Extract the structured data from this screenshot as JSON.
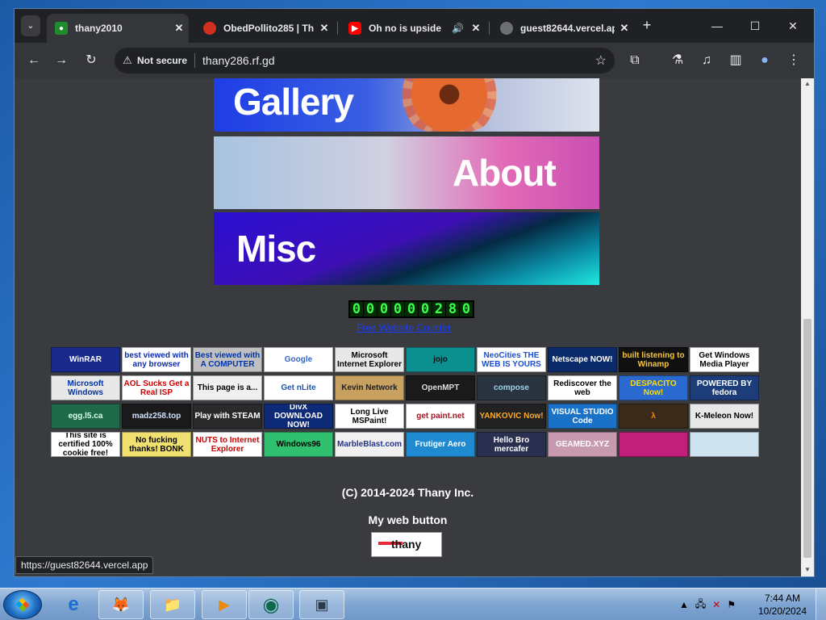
{
  "browser": {
    "tab_menu_icon": "chevron-down-icon",
    "tabs": [
      {
        "title": "thany2010",
        "favicon": "green-square",
        "active": true
      },
      {
        "title": "ObedPollito285 | Th",
        "favicon": "red-fire",
        "active": false
      },
      {
        "title": "Oh no is upside",
        "favicon": "youtube-red",
        "active": false,
        "audio": "🔊"
      },
      {
        "title": "guest82644.vercel.ap",
        "favicon": "globe",
        "active": false
      }
    ],
    "tab_close_glyph": "✕",
    "new_tab_glyph": "+",
    "window_controls": {
      "minimize": "—",
      "maximize": "☐",
      "close": "✕"
    },
    "toolbar": {
      "back": "←",
      "forward": "→",
      "reload": "↻",
      "security_icon": "⚠",
      "security_label": "Not secure",
      "url": "thany286.rf.gd",
      "bookmark": "☆",
      "extensions": "⧉",
      "labs": "⚗",
      "media": "♫",
      "sidepanel": "▥",
      "profile": "●",
      "menu": "⋮"
    },
    "status_url": "https://guest82644.vercel.app"
  },
  "page": {
    "nav": {
      "gallery": "Gallery",
      "about": "About",
      "misc": "Misc"
    },
    "counter_digits": [
      "0",
      "0",
      "0",
      "0",
      "0",
      "0",
      "2",
      "8",
      "0"
    ],
    "counter_link": "Free Website Counter",
    "buttons": [
      [
        {
          "text": "WinRAR",
          "bg": "#1a2a8c",
          "fg": "#ffffff"
        },
        {
          "text": "best viewed with any browser",
          "bg": "#ffffff",
          "fg": "#0b2bb0"
        },
        {
          "text": "Best viewed with A COMPUTER",
          "bg": "#c0c0c0",
          "fg": "#0033aa"
        },
        {
          "text": "Google",
          "bg": "#ffffff",
          "fg": "#3366cc"
        },
        {
          "text": "Microsoft Internet Explorer",
          "bg": "#e8e8e8",
          "fg": "#000000"
        },
        {
          "text": "jojo",
          "bg": "#0b8f8f",
          "fg": "#111111"
        },
        {
          "text": "NeoCities THE WEB IS YOURS",
          "bg": "#ffffff",
          "fg": "#1a4fd0"
        },
        {
          "text": "Netscape NOW!",
          "bg": "#0b2a6a",
          "fg": "#ffffff"
        },
        {
          "text": "built listening to Winamp",
          "bg": "#101010",
          "fg": "#f5c542"
        },
        {
          "text": "Get Windows Media Player",
          "bg": "#ffffff",
          "fg": "#000000"
        }
      ],
      [
        {
          "text": "Microsoft Windows",
          "bg": "#e8e8e8",
          "fg": "#0033aa"
        },
        {
          "text": "AOL Sucks Get a Real ISP",
          "bg": "#ffffff",
          "fg": "#cc0000"
        },
        {
          "text": "This page is a...",
          "bg": "#f0f0f0",
          "fg": "#000000"
        },
        {
          "text": "Get nLite",
          "bg": "#ffffff",
          "fg": "#2255aa"
        },
        {
          "text": "Kevin Network",
          "bg": "#c8a060",
          "fg": "#222222"
        },
        {
          "text": "OpenMPT",
          "bg": "#1a1a1a",
          "fg": "#dddddd"
        },
        {
          "text": "compose",
          "bg": "#2a3440",
          "fg": "#9ad0e8"
        },
        {
          "text": "Rediscover the web",
          "bg": "#ffffff",
          "fg": "#000000"
        },
        {
          "text": "DESPACITO Now!",
          "bg": "#2a6ad0",
          "fg": "#ffdd00"
        },
        {
          "text": "POWERED BY fedora",
          "bg": "#1d3d7a",
          "fg": "#ffffff"
        }
      ],
      [
        {
          "text": "egg.l5.ca",
          "bg": "#1f6a4a",
          "fg": "#d8ffe8"
        },
        {
          "text": "madz258.top",
          "bg": "#1a1a1a",
          "fg": "#cfe2ff"
        },
        {
          "text": "Play with STEAM",
          "bg": "#2a2a2a",
          "fg": "#ffffff"
        },
        {
          "text": "DivX DOWNLOAD NOW!",
          "bg": "#0d2a78",
          "fg": "#ffffff"
        },
        {
          "text": "Long Live MSPaint!",
          "bg": "#ffffff",
          "fg": "#000000"
        },
        {
          "text": "get paint.net",
          "bg": "#ffffff",
          "fg": "#b01020"
        },
        {
          "text": "YANKOVIC Now!",
          "bg": "#222222",
          "fg": "#ffaa22"
        },
        {
          "text": "VISUAL STUDIO Code",
          "bg": "#1a72c8",
          "fg": "#ffffff"
        },
        {
          "text": "λ",
          "bg": "#3a2a1a",
          "fg": "#ff8800"
        },
        {
          "text": "K-Meleon Now!",
          "bg": "#e8e8e8",
          "fg": "#000000"
        }
      ],
      [
        {
          "text": "This site is certified 100% cookie free!",
          "bg": "#ffffff",
          "fg": "#000000"
        },
        {
          "text": "No fucking thanks! BONK",
          "bg": "#f0e070",
          "fg": "#000000"
        },
        {
          "text": "NUTS to Internet Explorer",
          "bg": "#ffffff",
          "fg": "#cc0000"
        },
        {
          "text": "Windows96",
          "bg": "#30c070",
          "fg": "#000000"
        },
        {
          "text": "MarbleBlast.com",
          "bg": "#f0f0f0",
          "fg": "#223388"
        },
        {
          "text": "Frutiger Aero",
          "bg": "#1f8ad0",
          "fg": "#ffffff"
        },
        {
          "text": "Hello Bro mercafer",
          "bg": "#2a3050",
          "fg": "#ffffff"
        },
        {
          "text": "GEAMED.XYZ",
          "bg": "#c89ab0",
          "fg": "#ffffff"
        },
        {
          "text": "",
          "bg": "#c0207a",
          "fg": "#ffffff"
        },
        {
          "text": "",
          "bg": "#cfe2f0",
          "fg": "#ffffff"
        }
      ]
    ],
    "copyright": "(C) 2014-2024 Thany Inc.",
    "web_button_label": "My web button",
    "web_button_text": "thany"
  },
  "taskbar": {
    "apps": [
      {
        "name": "internet-explorer",
        "glyph": "e"
      },
      {
        "name": "firefox",
        "glyph": "🦊"
      },
      {
        "name": "file-explorer",
        "glyph": "📁"
      },
      {
        "name": "media-player",
        "glyph": "▶"
      },
      {
        "name": "chrome-like",
        "glyph": "◉"
      },
      {
        "name": "window",
        "glyph": "▣"
      }
    ],
    "tray_chevron": "▲",
    "clock_time": "7:44 AM",
    "clock_date": "10/20/2024"
  }
}
